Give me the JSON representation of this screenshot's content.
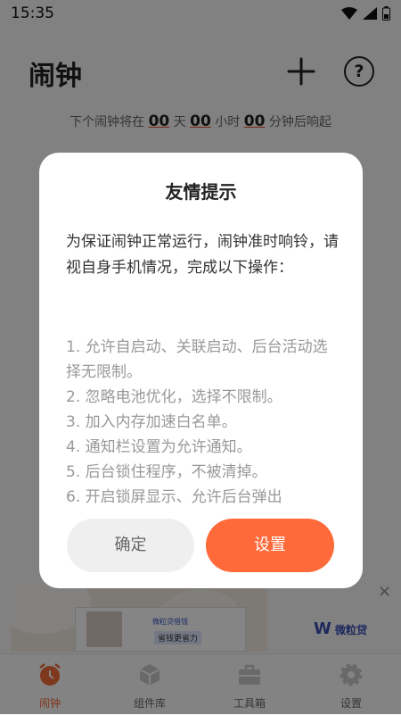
{
  "status_bar": {
    "time": "15:35"
  },
  "header": {
    "title": "闹钟",
    "plus_icon": "plus-icon",
    "help_label": "?"
  },
  "next_alarm": {
    "prefix": "下个闹钟将在",
    "days": "00",
    "days_unit": "天",
    "hours": "00",
    "hours_unit": "小时",
    "minutes": "00",
    "minutes_suffix": "分钟后响起"
  },
  "ad": {
    "brand": "微粒贷借钱",
    "slogan": "省钱更省力",
    "logo": "微粒贷",
    "close_label": "×"
  },
  "tabs": [
    {
      "label": "闹钟",
      "icon": "alarm-clock-icon",
      "active": true
    },
    {
      "label": "组件库",
      "icon": "widget-cube-icon",
      "active": false
    },
    {
      "label": "工具箱",
      "icon": "toolbox-icon",
      "active": false
    },
    {
      "label": "设置",
      "icon": "gear-icon",
      "active": false
    }
  ],
  "dialog": {
    "title": "友情提示",
    "intro": "为保证闹钟正常运行，闹钟准时响铃，请视自身手机情况，完成以下操作：",
    "steps": [
      "1. 允许自启动、关联启动、后台活动选择无限制。",
      "2. 忽略电池优化，选择不限制。",
      "3. 加入内存加速白名单。",
      "4. 通知栏设置为允许通知。",
      "5. 后台锁住程序，不被清掉。",
      "6. 开启锁屏显示、允许后台弹出"
    ],
    "confirm_label": "确定",
    "settings_label": "设置"
  },
  "colors": {
    "accent": "#ff6a3a",
    "overlay": "rgba(0,0,0,0.48)"
  }
}
